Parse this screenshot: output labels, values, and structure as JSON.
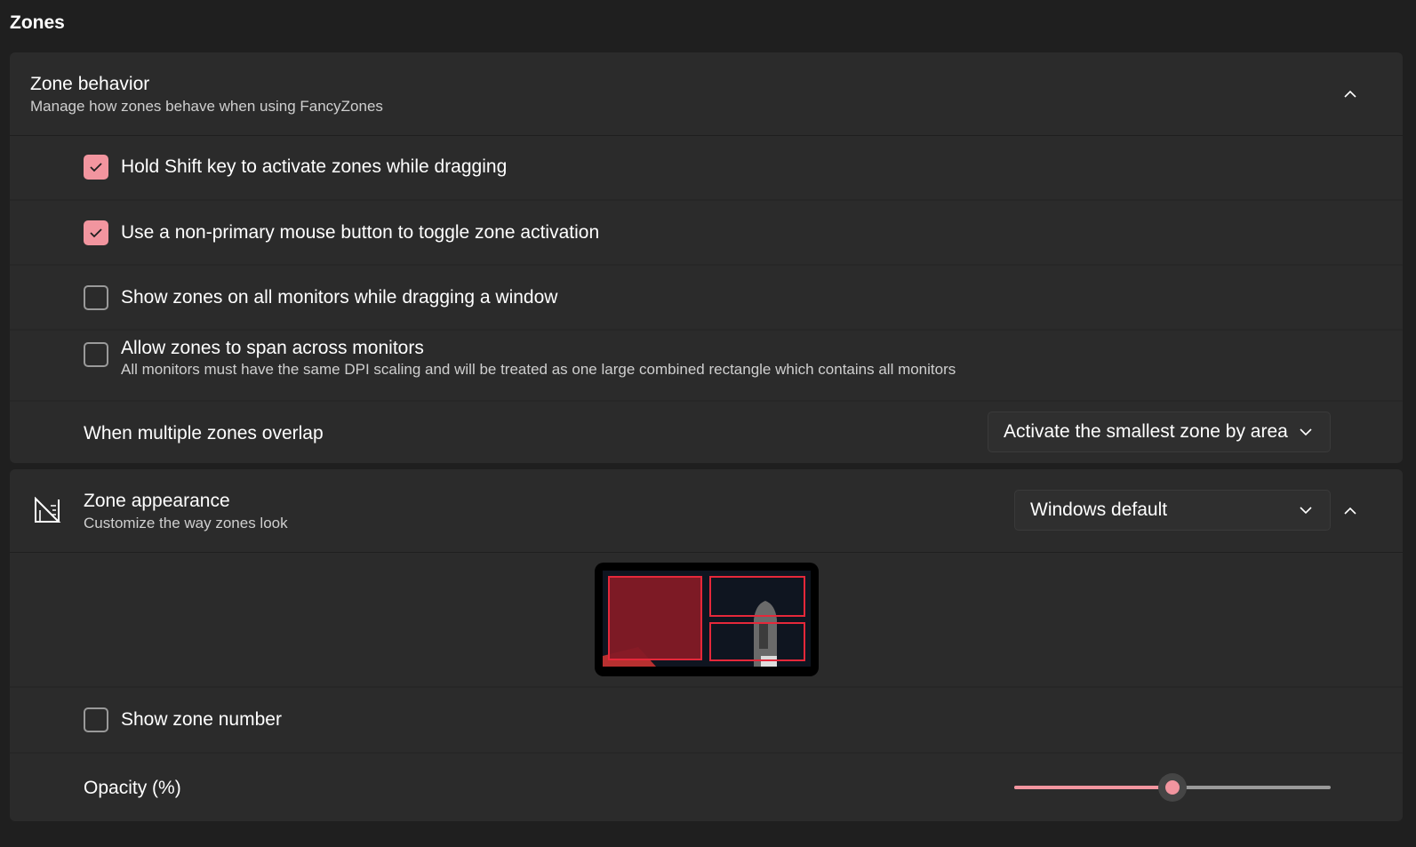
{
  "page_title": "Zones",
  "colors": {
    "accent": "#f2959f",
    "background": "#1f1f1f",
    "card": "#2b2b2b",
    "zone_border": "#e5283a",
    "zone_fill": "#841a26"
  },
  "zone_behavior": {
    "title": "Zone behavior",
    "description": "Manage how zones behave when using FancyZones",
    "expanded": true,
    "icon": "chevron-up-icon",
    "options": [
      {
        "label": "Hold Shift key to activate zones while dragging",
        "checked": true
      },
      {
        "label": "Use a non-primary mouse button to toggle zone activation",
        "checked": true
      },
      {
        "label": "Show zones on all monitors while dragging a window",
        "checked": false
      },
      {
        "label": "Allow zones to span across monitors",
        "description": "All monitors must have the same DPI scaling and will be treated as one large combined rectangle which contains all monitors",
        "checked": false
      }
    ],
    "overlap": {
      "label": "When multiple zones overlap",
      "selected": "Activate the smallest zone by area"
    }
  },
  "zone_appearance": {
    "title": "Zone appearance",
    "description": "Customize the way zones look",
    "icon": "ruler-triangle-icon",
    "theme_selected": "Windows default",
    "expanded": true,
    "show_zone_number": {
      "label": "Show zone number",
      "checked": false
    },
    "opacity": {
      "label": "Opacity (%)",
      "value": 50
    }
  }
}
